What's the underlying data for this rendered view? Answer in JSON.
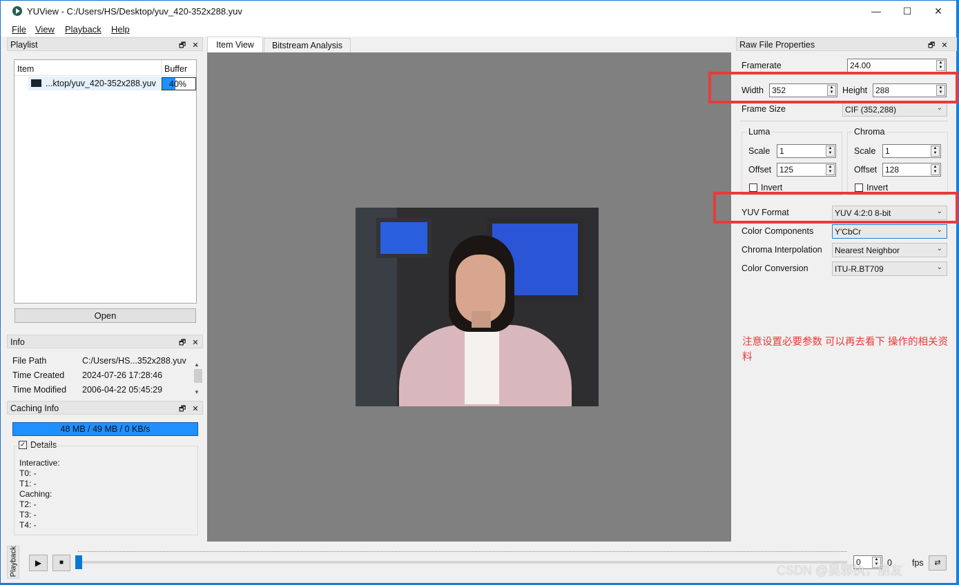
{
  "window": {
    "title": "YUView - C:/Users/HS/Desktop/yuv_420-352x288.yuv"
  },
  "menu": [
    {
      "label": "File"
    },
    {
      "label": "View"
    },
    {
      "label": "Playback"
    },
    {
      "label": "Help"
    }
  ],
  "playlist": {
    "title": "Playlist",
    "col_item": "Item",
    "col_buffer": "Buffer",
    "file": "...ktop/yuv_420-352x288.yuv",
    "buffer": 40,
    "buffer_label": "40%",
    "open_label": "Open"
  },
  "info": {
    "title": "Info",
    "rows": [
      {
        "key": "File Path",
        "value": "C:/Users/HS...352x288.yuv"
      },
      {
        "key": "Time Created",
        "value": "2024-07-26 17:28:46"
      },
      {
        "key": "Time Modified",
        "value": "2006-04-22 05:45:29"
      }
    ]
  },
  "caching": {
    "title": "Caching Info",
    "bar_text": "48 MB / 49 MB / 0 KB/s",
    "details_label": "Details",
    "lines": [
      "Interactive:",
      "T0: -",
      "T1: -",
      "Caching:",
      "T2: -",
      "T3: -",
      "T4: -"
    ]
  },
  "tabs": [
    {
      "label": "Item View"
    },
    {
      "label": "Bitstream Analysis"
    }
  ],
  "props": {
    "title": "Raw File Properties",
    "framerate_label": "Framerate",
    "framerate": "24.00",
    "width_label": "Width",
    "width": "352",
    "height_label": "Height",
    "height": "288",
    "frame_size_label": "Frame Size",
    "frame_size": "CIF (352,288)",
    "luma": {
      "title": "Luma",
      "scale_label": "Scale",
      "scale": "1",
      "offset_label": "Offset",
      "offset": "125",
      "invert_label": "Invert"
    },
    "chroma": {
      "title": "Chroma",
      "scale_label": "Scale",
      "scale": "1",
      "offset_label": "Offset",
      "offset": "128",
      "invert_label": "Invert"
    },
    "yuv_format_label": "YUV Format",
    "yuv_format": "YUV 4:2:0 8-bit",
    "color_components_label": "Color Components",
    "color_components": "Y'CbCr",
    "chroma_interp_label": "Chroma Interpolation",
    "chroma_interp": "Nearest Neighbor",
    "color_conv_label": "Color Conversion",
    "color_conv": "ITU-R.BT709"
  },
  "note": "注意设置必要参数  可以再去看下 操作的相关资料",
  "playback": {
    "side_label": "Playback",
    "frame": "0",
    "frame_max": "0",
    "fps_label": "fps",
    "watermark": "CSDN @吴邪执，朋友"
  },
  "colors": {
    "accent": "#1e90ff",
    "annotation": "#ea3a3a",
    "viewer_bg": "#808080"
  }
}
